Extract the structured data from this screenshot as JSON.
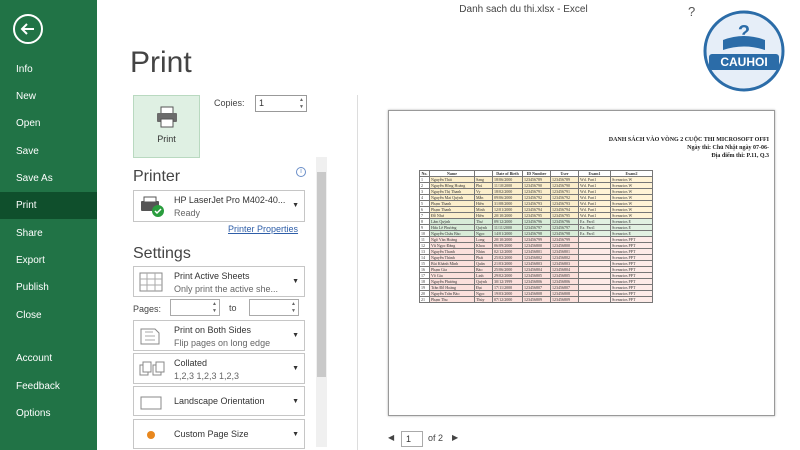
{
  "window": {
    "title": "Danh sach du thi.xlsx  -  Excel",
    "help": "?"
  },
  "sidebar": {
    "items": [
      {
        "label": "Info"
      },
      {
        "label": "New"
      },
      {
        "label": "Open"
      },
      {
        "label": "Save"
      },
      {
        "label": "Save As"
      },
      {
        "label": "Print",
        "active": true
      },
      {
        "label": "Share"
      },
      {
        "label": "Export"
      },
      {
        "label": "Publish"
      },
      {
        "label": "Close"
      },
      {
        "label": "Account"
      },
      {
        "label": "Feedback"
      },
      {
        "label": "Options"
      }
    ]
  },
  "logo": {
    "text": "CAUHOI"
  },
  "print": {
    "heading": "Print",
    "button_label": "Print",
    "copies_label": "Copies:",
    "copies_value": "1"
  },
  "printer": {
    "section_title": "Printer",
    "name": "HP LaserJet Pro M402-40...",
    "status": "Ready",
    "properties_link": "Printer Properties"
  },
  "settings": {
    "section_title": "Settings",
    "active_sheets": {
      "title": "Print Active Sheets",
      "subtitle": "Only print the active she..."
    },
    "pages_label": "Pages:",
    "to_label": "to",
    "sides": {
      "title": "Print on Both Sides",
      "subtitle": "Flip pages on long edge"
    },
    "collated": {
      "title": "Collated",
      "subtitle": "1,2,3    1,2,3    1,2,3"
    },
    "orientation": {
      "title": "Landscape Orientation"
    },
    "page_size": {
      "title": "Custom Page Size"
    }
  },
  "preview": {
    "doc_title": "DANH SÁCH VÀO VÒNG 2 CUỘC THI MICROSOFT OFFI",
    "doc_date": "Ngày thi: Chủ Nhật ngày 07-06-",
    "doc_place": "Địa điểm thi: P.11, Q.3",
    "headers": [
      "No.",
      "Name",
      "",
      "Date of Birth",
      "ID Number",
      "User",
      "Exam1",
      "Exam2"
    ],
    "rows": [
      [
        "1",
        "Nguyễn Thái",
        "Sang",
        "18/06/2000",
        "123456789",
        "123456789",
        "Wd. Part1",
        "Scenarios W"
      ],
      [
        "2",
        "Nguyễn Hồng Hoàng",
        "Phú",
        "11/10/2000",
        "123456790",
        "123456790",
        "Wd. Part1",
        "Scenarios W"
      ],
      [
        "3",
        "Nguyễn Thị Thanh",
        "Vy",
        "18/02/2000",
        "123456791",
        "123456791",
        "Wd. Part1",
        "Scenarios W"
      ],
      [
        "4",
        "Nguyễn Mai Quỳnh",
        "Mẫn",
        "09/06/2000",
        "123456792",
        "123456792",
        "Wd. Part1",
        "Scenarios W"
      ],
      [
        "5",
        "Phạm Thanh",
        "Hiền",
        "31/08/2000",
        "123456793",
        "123456793",
        "Wd. Part1",
        "Scenarios W"
      ],
      [
        "6",
        "Phạm Thanh",
        "Minh",
        "12/01/2000",
        "123456794",
        "123456794",
        "Wd. Part1",
        "Scenarios W"
      ],
      [
        "7",
        "Đỗ Như",
        "Hiền",
        "20/10/2000",
        "123456795",
        "123456795",
        "Wd. Part1",
        "Scenarios W"
      ],
      [
        "8",
        "Lâm Quỳnh",
        "Thư",
        "09/12/2000",
        "123456796",
        "123456796",
        "Ex. Part1",
        "Scenarios E"
      ],
      [
        "9",
        "Hứa Lê Phương",
        "Quỳnh",
        "11/11/2000",
        "123456797",
        "123456797",
        "Ex. Part1",
        "Scenarios E"
      ],
      [
        "10",
        "Nguyễn Châu Bảo",
        "Ngọc",
        "14/01/2000",
        "123456798",
        "123456798",
        "Ex. Part1",
        "Scenarios E"
      ],
      [
        "11",
        "Ngô Văn Hoàng",
        "Long",
        "20/10/2000",
        "123456799",
        "123456799",
        "",
        "Scenarios PPT"
      ],
      [
        "12",
        "Vũ Ngọc Đăng",
        "Khoa",
        "06/09/2000",
        "123456800",
        "123456800",
        "",
        "Scenarios PPT"
      ],
      [
        "13",
        "Nguyễn Thanh",
        "Nhàn",
        "02/12/2000",
        "123456801",
        "123456801",
        "",
        "Scenarios PPT"
      ],
      [
        "14",
        "Nguyễn Thành",
        "Phát",
        "25/02/2000",
        "123456802",
        "123456802",
        "",
        "Scenarios PPT"
      ],
      [
        "15",
        "Bùi Khánh Minh",
        "Quân",
        "21/03/2000",
        "123456803",
        "123456803",
        "",
        "Scenarios PPT"
      ],
      [
        "16",
        "Phạm Gia",
        "Bảo",
        "25/06/2000",
        "123456804",
        "123456804",
        "",
        "Scenarios PPT"
      ],
      [
        "17",
        "Võ Gia",
        "Linh",
        "29/02/2000",
        "123456805",
        "123456805",
        "",
        "Scenarios PPT"
      ],
      [
        "18",
        "Nguyễn Phương",
        "Quỳnh",
        "30/12/1999",
        "123456806",
        "123456806",
        "",
        "Scenarios PPT"
      ],
      [
        "19",
        "Trần Đỗ Hoàng",
        "Đạt",
        "17/11/2000",
        "123456807",
        "123456807",
        "",
        "Scenarios PPT"
      ],
      [
        "20",
        "Nguyễn Trần Bảo",
        "Ngọc",
        "19/03/2000",
        "123456808",
        "123456808",
        "",
        "Scenarios PPT"
      ],
      [
        "21",
        "Phạm Thu",
        "Thủy",
        "07/12/2000",
        "123456809",
        "123456809",
        "",
        "Scenarios PPT"
      ]
    ],
    "page_current": "1",
    "page_total_label": "of 2"
  },
  "colors": {
    "sidebar": "#217346",
    "sidebar_active": "#0f4f2c",
    "print_button": "#dff0e3"
  }
}
